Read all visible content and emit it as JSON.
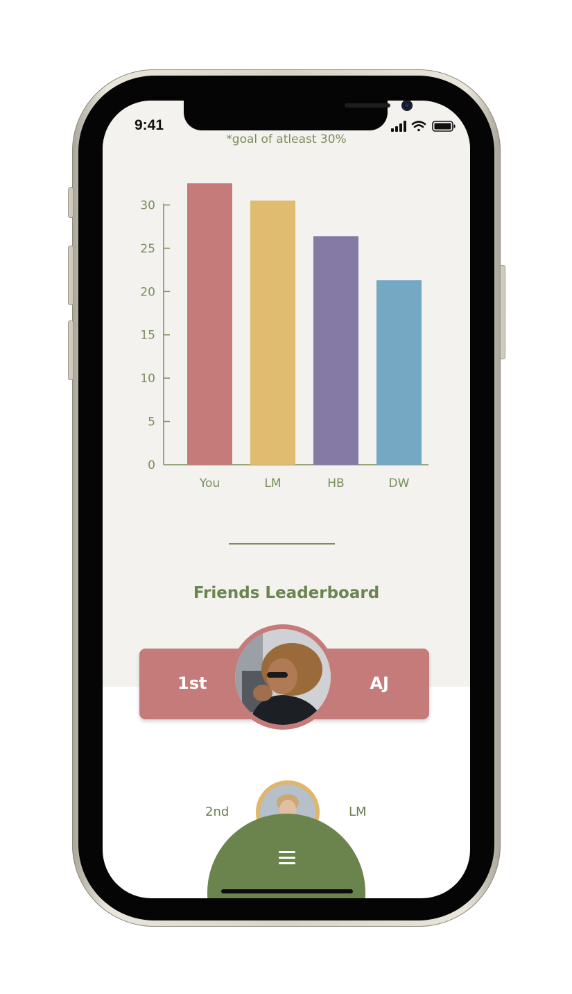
{
  "status_bar": {
    "time": "9:41",
    "icons": [
      "cellular-signal-icon",
      "wifi-icon",
      "battery-icon"
    ]
  },
  "goal_note": "*goal of atleast 30%",
  "chart_data": {
    "type": "bar",
    "categories": [
      "You",
      "LM",
      "HB",
      "DW"
    ],
    "values": [
      32.5,
      30.5,
      26.4,
      21.3
    ],
    "colors": [
      "#c47b79",
      "#e0bc71",
      "#857aa5",
      "#75a8c3"
    ],
    "yticks": [
      0,
      5,
      10,
      15,
      20,
      25,
      30
    ],
    "ylim": [
      0,
      33
    ],
    "axis_color": "#7a8d5b",
    "grid": false
  },
  "leaderboard": {
    "title": "Friends Leaderboard",
    "entries": [
      {
        "rank": "1st",
        "name": "AJ",
        "color": "#c47b79"
      },
      {
        "rank": "2nd",
        "name": "LM",
        "color": "#dfb66a"
      }
    ]
  },
  "nav": {
    "menu_icon": "hamburger-menu-icon",
    "color": "#6b834c"
  }
}
